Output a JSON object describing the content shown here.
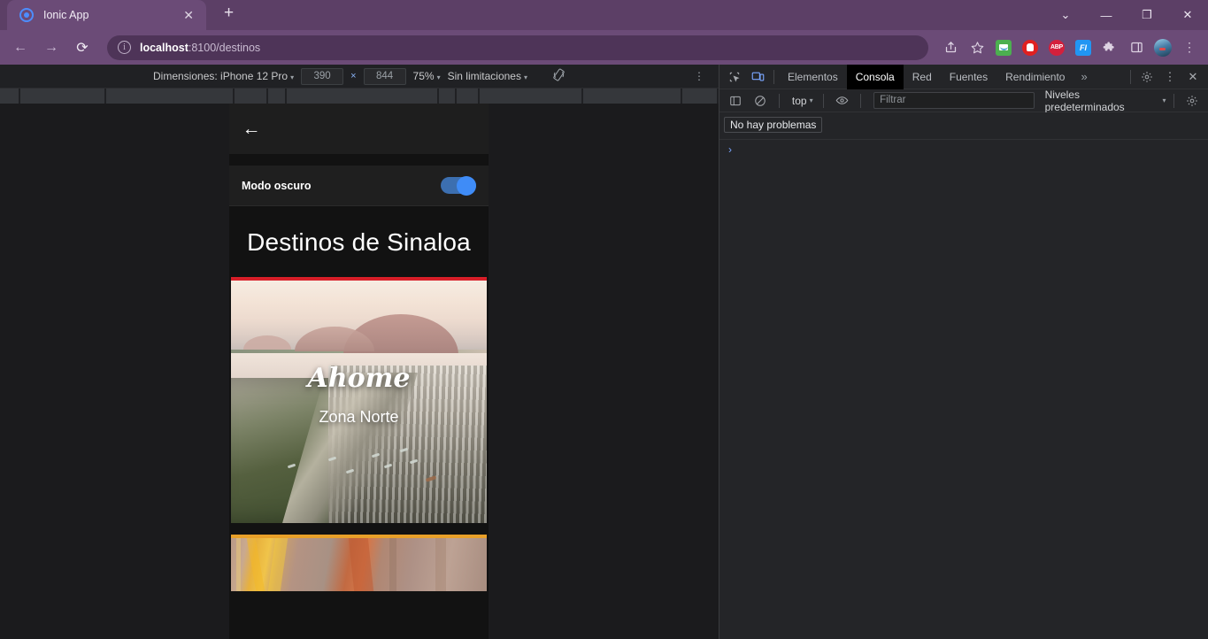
{
  "browser": {
    "tab": {
      "title": "Ionic App",
      "favicon": "ionic-logo-icon",
      "close": "✕"
    },
    "new_tab_label": "+",
    "window_controls": {
      "minimize": "—",
      "maximize": "❐",
      "close": "✕",
      "more": "⌄"
    },
    "nav": {
      "back": "←",
      "forward": "→",
      "reload": "⟳"
    },
    "omnibox": {
      "info_icon": "ⓘ",
      "url_host": "localhost",
      "url_rest": ":8100/destinos",
      "full_url": "localhost:8100/destinos"
    },
    "toolbar_icons": [
      {
        "name": "share-icon",
        "glyph": "↗"
      },
      {
        "name": "bookmark-star-icon",
        "glyph": "☆"
      },
      {
        "name": "mail-extension-icon",
        "label": ""
      },
      {
        "name": "stop-extension-icon",
        "label": ""
      },
      {
        "name": "adblock-plus-extension-icon",
        "label": "ABP"
      },
      {
        "name": "fi-extension-icon",
        "label": "FI"
      },
      {
        "name": "extensions-puzzle-icon",
        "glyph": "🧩"
      },
      {
        "name": "side-panel-icon",
        "glyph": "▯"
      },
      {
        "name": "profile-avatar",
        "label": ""
      },
      {
        "name": "chrome-menu-kebab-icon",
        "glyph": "⋮"
      }
    ]
  },
  "device_toolbar": {
    "dimensions_label": "Dimensiones: iPhone 12 Pro",
    "width": "390",
    "height": "844",
    "x_separator": "×",
    "zoom": "75%",
    "throttling": "Sin limitaciones",
    "rotate_icon": "rotate-device-icon",
    "kebab": "⋮",
    "caret": "▾"
  },
  "devtools": {
    "inspect_icon": "inspect-element-icon",
    "device_icon": "toggle-device-toolbar-icon",
    "tabs": [
      {
        "label": "Elementos",
        "selected": false
      },
      {
        "label": "Consola",
        "selected": true
      },
      {
        "label": "Red",
        "selected": false
      },
      {
        "label": "Fuentes",
        "selected": false
      },
      {
        "label": "Rendimiento",
        "selected": false
      }
    ],
    "more_tabs": "»",
    "settings_icon": "settings-gear-icon",
    "kebab_icon": "⋮",
    "close_icon": "✕",
    "console": {
      "sidebar_toggle_icon": "console-sidebar-icon",
      "clear_icon": "⊘",
      "context": "top",
      "caret": "▾",
      "eye_icon": "live-expression-eye-icon",
      "filter_placeholder": "Filtrar",
      "filter_value": "",
      "levels": "Niveles predeterminados",
      "settings_icon": "console-settings-gear-icon",
      "issues_badge": "No hay problemas",
      "prompt": "›"
    }
  },
  "app": {
    "back_icon": "←",
    "dark_mode_label": "Modo oscuro",
    "dark_mode_on": true,
    "page_title": "Destinos de Sinaloa",
    "cards": [
      {
        "name": "Ahome",
        "subtitle": "Zona Norte",
        "accent_color": "#d81e28",
        "image": "ahome-malecon-aerial-photo"
      },
      {
        "name": "",
        "subtitle": "",
        "accent_color": "#e8a029",
        "image": "canyon-rock-formation-photo"
      }
    ]
  },
  "colors": {
    "browser_chrome": "#6b4b77",
    "tabstrip": "#5c3f66",
    "devtools_bg": "#242528",
    "app_bg": "#121212",
    "toggle_on": "#3f8cf7",
    "accent_red": "#d81e28",
    "accent_orange": "#e8a029"
  }
}
